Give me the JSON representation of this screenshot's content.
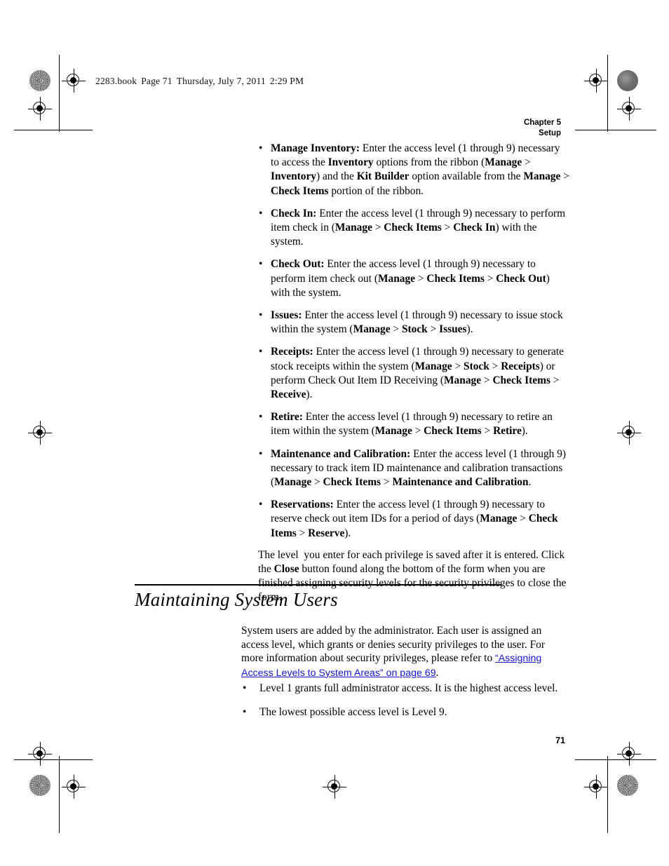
{
  "page": {
    "book_slug": "2283.book",
    "page_label": "Page 71",
    "date_label": "Thursday, July 7, 2011",
    "time_label": "2:29 PM",
    "folio": "71"
  },
  "running_head": {
    "line1": "Chapter 5",
    "line2": "Setup"
  },
  "bullet_glyph": "•",
  "privilege_bullets": [
    {
      "id": "manage-inventory",
      "term": "Manage Inventory:",
      "html": "<b>Manage Inventory:</b> Enter the access level (1 through 9) necessary to access the <b>Inventory</b> options from the ribbon (<b>Manage</b> &gt; <b>Inventory</b>) and the <b>Kit Builder</b> option available from the <b>Manage</b> &gt; <b>Check Items</b> portion of the ribbon."
    },
    {
      "id": "check-in",
      "term": "Check In:",
      "html": "<b>Check In:</b> Enter the access level (1 through 9) necessary to perform item check in (<b>Manage</b> &gt; <b>Check Items</b> &gt; <b>Check In</b>) with the system."
    },
    {
      "id": "check-out",
      "term": "Check Out:",
      "html": "<b>Check Out:</b> Enter the access level (1 through 9) necessary to perform item check out (<b>Manage</b> &gt; <b>Check Items</b> &gt; <b>Check Out</b>) with the system."
    },
    {
      "id": "issues",
      "term": "Issues:",
      "html": "<b>Issues:</b> Enter the access level (1 through 9) necessary to issue stock within the system (<b>Manage</b> &gt; <b>Stock</b> &gt; <b>Issues</b>)."
    },
    {
      "id": "receipts",
      "term": "Receipts:",
      "html": "<b>Receipts:</b> Enter the access level (1 through 9) necessary to generate stock receipts within the system (<b>Manage</b> &gt; <b>Stock</b> &gt; <b>Receipts</b>) or perform Check Out Item ID Receiving (<b>Manage</b> &gt; <b>Check Items</b> &gt; <b>Receive</b>)."
    },
    {
      "id": "retire",
      "term": "Retire:",
      "html": "<b>Retire:</b> Enter the access level (1 through 9) necessary to retire an item within the system (<b>Manage</b> &gt; <b>Check Items</b> &gt; <b>Retire</b>)."
    },
    {
      "id": "maintenance-and-calibration",
      "term": "Maintenance and Calibration:",
      "html": "<b>Maintenance and Calibration:</b> Enter the access level (1 through 9) necessary to track item ID maintenance and calibration transactions (<b>Manage</b> &gt; <b>Check Items</b> &gt; <b>Maintenance and Calibration</b>."
    },
    {
      "id": "reservations",
      "term": "Reservations:",
      "html": "<b>Reservations:</b> Enter the access level (1 through 9) necessary to reserve check out item IDs for a period of days (<b>Manage</b> &gt; <b>Check Items</b> &gt; <b>Reserve</b>)."
    }
  ],
  "closing_paragraph": {
    "html": "The level&nbsp; you enter for each privilege is saved after it is entered. Click the <b>Close</b> button found along the bottom of the form when you are finished assigning security levels for the security privileges to close the form."
  },
  "section": {
    "heading": "Maintaining System Users",
    "intro_html": "System users are added by the administrator. Each user is assigned an access level, which grants or denies security privileges to the user. For more information about security privileges, please refer to <span class=\"xref\">“Assigning Access Levels to System Areas” on page 69</span>.",
    "link_text": "“Assigning Access Levels to System Areas” on page 69",
    "link_color": "#1414d6",
    "bullets": [
      "Level 1 grants full administrator access. It is the highest access level.",
      "The lowest possible access level is Level 9."
    ]
  }
}
